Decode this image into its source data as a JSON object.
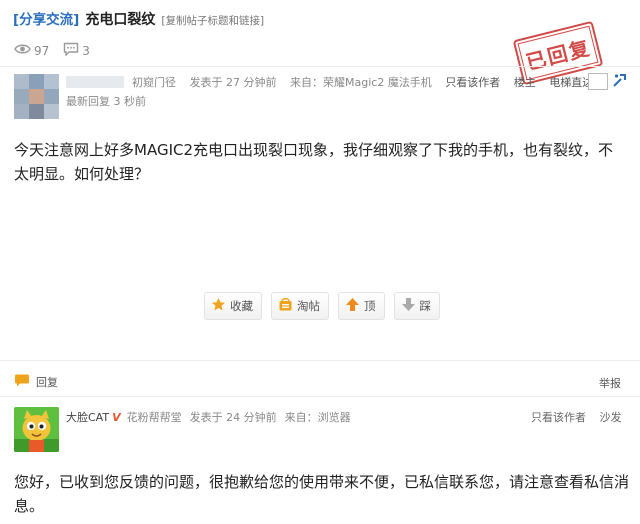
{
  "title": {
    "category": "[分享交流]",
    "text": "充电口裂纹",
    "copy_link": "[复制帖子标题和链接]"
  },
  "stats": {
    "views": "97",
    "replies": "3"
  },
  "stamp": {
    "text": "已回复",
    "color": "#cf3b38"
  },
  "post": {
    "author_group": "初窥门径",
    "posted": "发表于 27 分钟前",
    "source": "来自：荣耀Magic2 魔法手机",
    "author_only": "只看该作者",
    "floor": "楼主",
    "jump_label": "电梯直达",
    "latest_reply": "最新回复 3 秒前",
    "body": "今天注意网上好多MAGIC2充电口出现裂口现象，我仔细观察了下我的手机，也有裂纹，不太明显。如何处理？"
  },
  "actions": {
    "favorite": "收藏",
    "hotpost": "淘帖",
    "up": "顶",
    "down": "踩"
  },
  "reply_bar": {
    "reply_label": "回复",
    "report_label": "举报"
  },
  "reply": {
    "username": "大脸CAT",
    "badge": "V",
    "group": "花粉帮帮堂",
    "posted": "发表于 24 分钟前",
    "source": "来自：浏览器",
    "author_only": "只看该作者",
    "floor": "沙发",
    "body": "您好，已收到您反馈的问题，很抱歉给您的使用带来不便，已私信联系您，请注意查看私信消息。"
  },
  "icons": {
    "views": "eye-icon",
    "replies": "comment-icon",
    "jump": "elevator-jump-icon",
    "favorite": "star-icon",
    "hotpost": "basket-icon",
    "up": "up-arrow-icon",
    "down": "down-arrow-icon",
    "reply": "speech-bubble-icon"
  },
  "colors": {
    "category": "#2a6ebc",
    "accent_orange": "#f0a31c"
  }
}
